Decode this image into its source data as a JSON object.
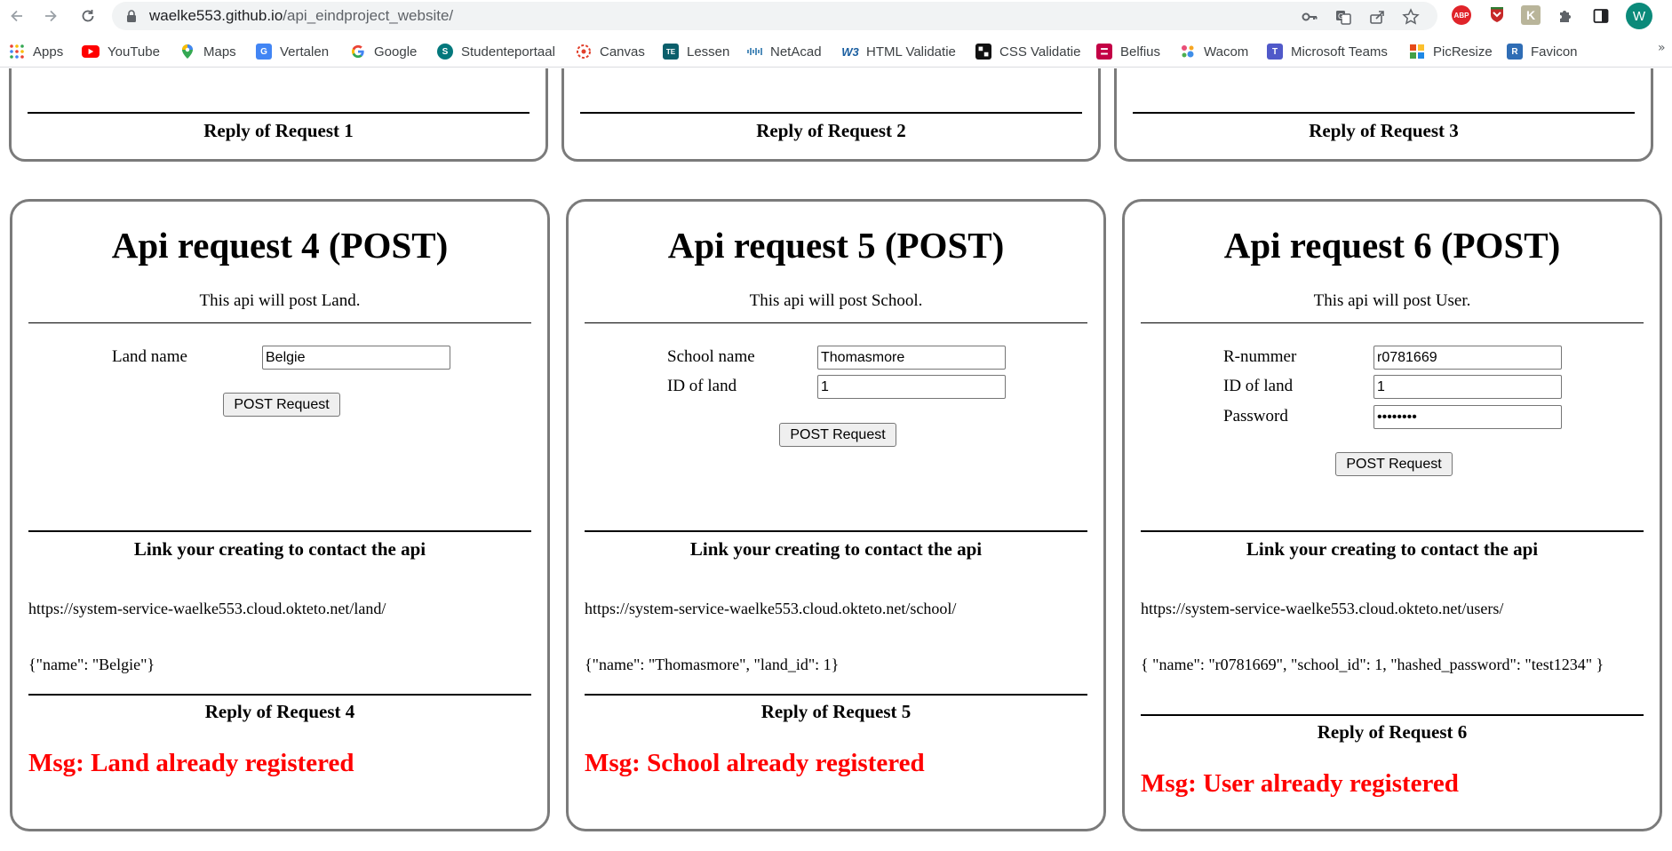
{
  "browser": {
    "url_host": "waelke553.github.io",
    "url_path": "/api_eindproject_website/",
    "profile_initial": "W",
    "extensions": [
      {
        "name": "abp-icon",
        "label": "ABP",
        "color": "#e0242a"
      },
      {
        "name": "shield-extension-icon",
        "label": "",
        "color": "#c62828"
      },
      {
        "name": "k-extension-icon",
        "label": "K",
        "color": "#b9b59a"
      }
    ]
  },
  "bookmarks": [
    {
      "name": "apps",
      "label": "Apps",
      "icon": "apps-grid-icon",
      "color": "#ea4335"
    },
    {
      "name": "youtube",
      "label": "YouTube",
      "icon": "youtube-icon",
      "color": "#ff0000"
    },
    {
      "name": "maps",
      "label": "Maps",
      "icon": "maps-pin-icon",
      "color": "#34a853"
    },
    {
      "name": "vertalen",
      "label": "Vertalen",
      "icon": "translate-icon",
      "color": "#4285f4"
    },
    {
      "name": "google",
      "label": "Google",
      "icon": "google-icon",
      "color": "#4285f4"
    },
    {
      "name": "studenteportaal",
      "label": "Studenteportaal",
      "icon": "sharepoint-icon",
      "color": "#03787c"
    },
    {
      "name": "canvas",
      "label": "Canvas",
      "icon": "canvas-icon",
      "color": "#e13f2b"
    },
    {
      "name": "lessen",
      "label": "Lessen",
      "icon": "te-icon",
      "color": "#0b5f6b"
    },
    {
      "name": "netacad",
      "label": "NetAcad",
      "icon": "cisco-icon",
      "color": "#1b6aa5"
    },
    {
      "name": "html-validatie",
      "label": "HTML Validatie",
      "icon": "w3-icon",
      "color": "#1a5ea0"
    },
    {
      "name": "css-validatie",
      "label": "CSS Validatie",
      "icon": "css-validator-icon",
      "color": "#111111"
    },
    {
      "name": "belfius",
      "label": "Belfius",
      "icon": "belfius-icon",
      "color": "#c30045"
    },
    {
      "name": "wacom",
      "label": "Wacom",
      "icon": "wacom-icon",
      "color": "#e94e77"
    },
    {
      "name": "microsoft-teams",
      "label": "Microsoft Teams",
      "icon": "teams-icon",
      "color": "#5059c9"
    },
    {
      "name": "picresize",
      "label": "PicResize",
      "icon": "picresize-icon",
      "color": "#e64a19"
    },
    {
      "name": "favicon",
      "label": "Favicon",
      "icon": "favicon-icon",
      "color": "#2f6db5"
    }
  ],
  "top_cards": [
    {
      "reply": "Reply of Request 1"
    },
    {
      "reply": "Reply of Request 2"
    },
    {
      "reply": "Reply of Request 3"
    }
  ],
  "cards": [
    {
      "title": "Api request 4 (POST)",
      "description": "This api will post Land.",
      "fields": [
        {
          "label": "Land name",
          "value": "Belgie"
        }
      ],
      "button": "POST Request",
      "link_title": "Link your creating to contact the api",
      "endpoint": "https://system-service-waelke553.cloud.okteto.net/land/",
      "body": "{\"name\": \"Belgie\"}",
      "reply": "Reply of Request 4",
      "message": "Msg: Land already registered"
    },
    {
      "title": "Api request 5 (POST)",
      "description": "This api will post School.",
      "fields": [
        {
          "label": "School name",
          "value": "Thomasmore"
        },
        {
          "label": "ID of land",
          "value": "1"
        }
      ],
      "button": "POST Request",
      "link_title": "Link your creating to contact the api",
      "endpoint": "https://system-service-waelke553.cloud.okteto.net/school/",
      "body": "{\"name\": \"Thomasmore\", \"land_id\": 1}",
      "reply": "Reply of Request 5",
      "message": "Msg: School already registered"
    },
    {
      "title": "Api request 6 (POST)",
      "description": "This api will post User.",
      "fields": [
        {
          "label": "R-nummer",
          "value": "r0781669"
        },
        {
          "label": "ID of land",
          "value": "1"
        },
        {
          "label": "Password",
          "value": "test1234",
          "type": "password"
        }
      ],
      "button": "POST Request",
      "link_title": "Link your creating to contact the api",
      "endpoint": "https://system-service-waelke553.cloud.okteto.net/users/",
      "body": "{ \"name\": \"r0781669\", \"school_id\": 1, \"hashed_password\": \"test1234\" }",
      "reply": "Reply of Request 6",
      "message": "Msg: User already registered"
    }
  ]
}
